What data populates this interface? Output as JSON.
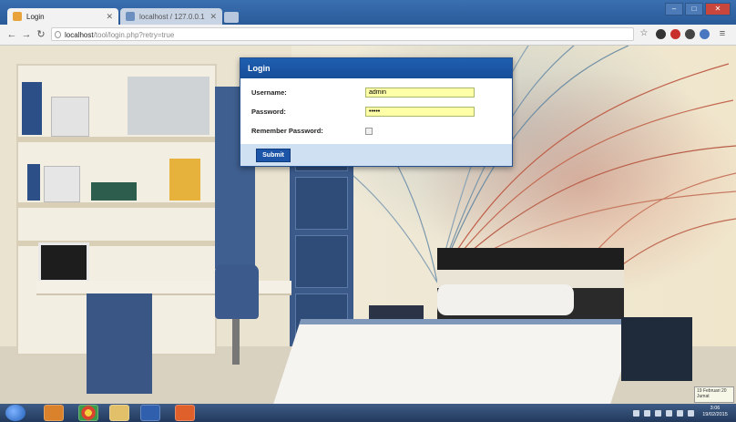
{
  "browser": {
    "tabs": [
      {
        "label": "Login",
        "active": true
      },
      {
        "label": "localhost / 127.0.0.1",
        "active": false
      }
    ],
    "url_host": "localhost",
    "url_path": "/tool/login.php?retry=true"
  },
  "login": {
    "title": "Login",
    "username_label": "Username:",
    "username_value": "admin",
    "password_label": "Password:",
    "password_value": "•••••",
    "remember_label": "Remember Password:",
    "remember_checked": false,
    "submit_label": "Submit"
  },
  "taskbar": {
    "clock_time": "3:06",
    "clock_date": "19/02/2015"
  },
  "notification": {
    "line1": "19 Februari 20",
    "line2": "Jumat"
  },
  "colors": {
    "accent": "#1c55a8",
    "field_bg": "#ffffa8",
    "tab_bar": "#2a5a98"
  },
  "icons": [
    "back-icon",
    "forward-icon",
    "reload-icon",
    "lock-icon",
    "star-icon",
    "extension-icons",
    "start-icon",
    "taskbar-app-icons"
  ]
}
